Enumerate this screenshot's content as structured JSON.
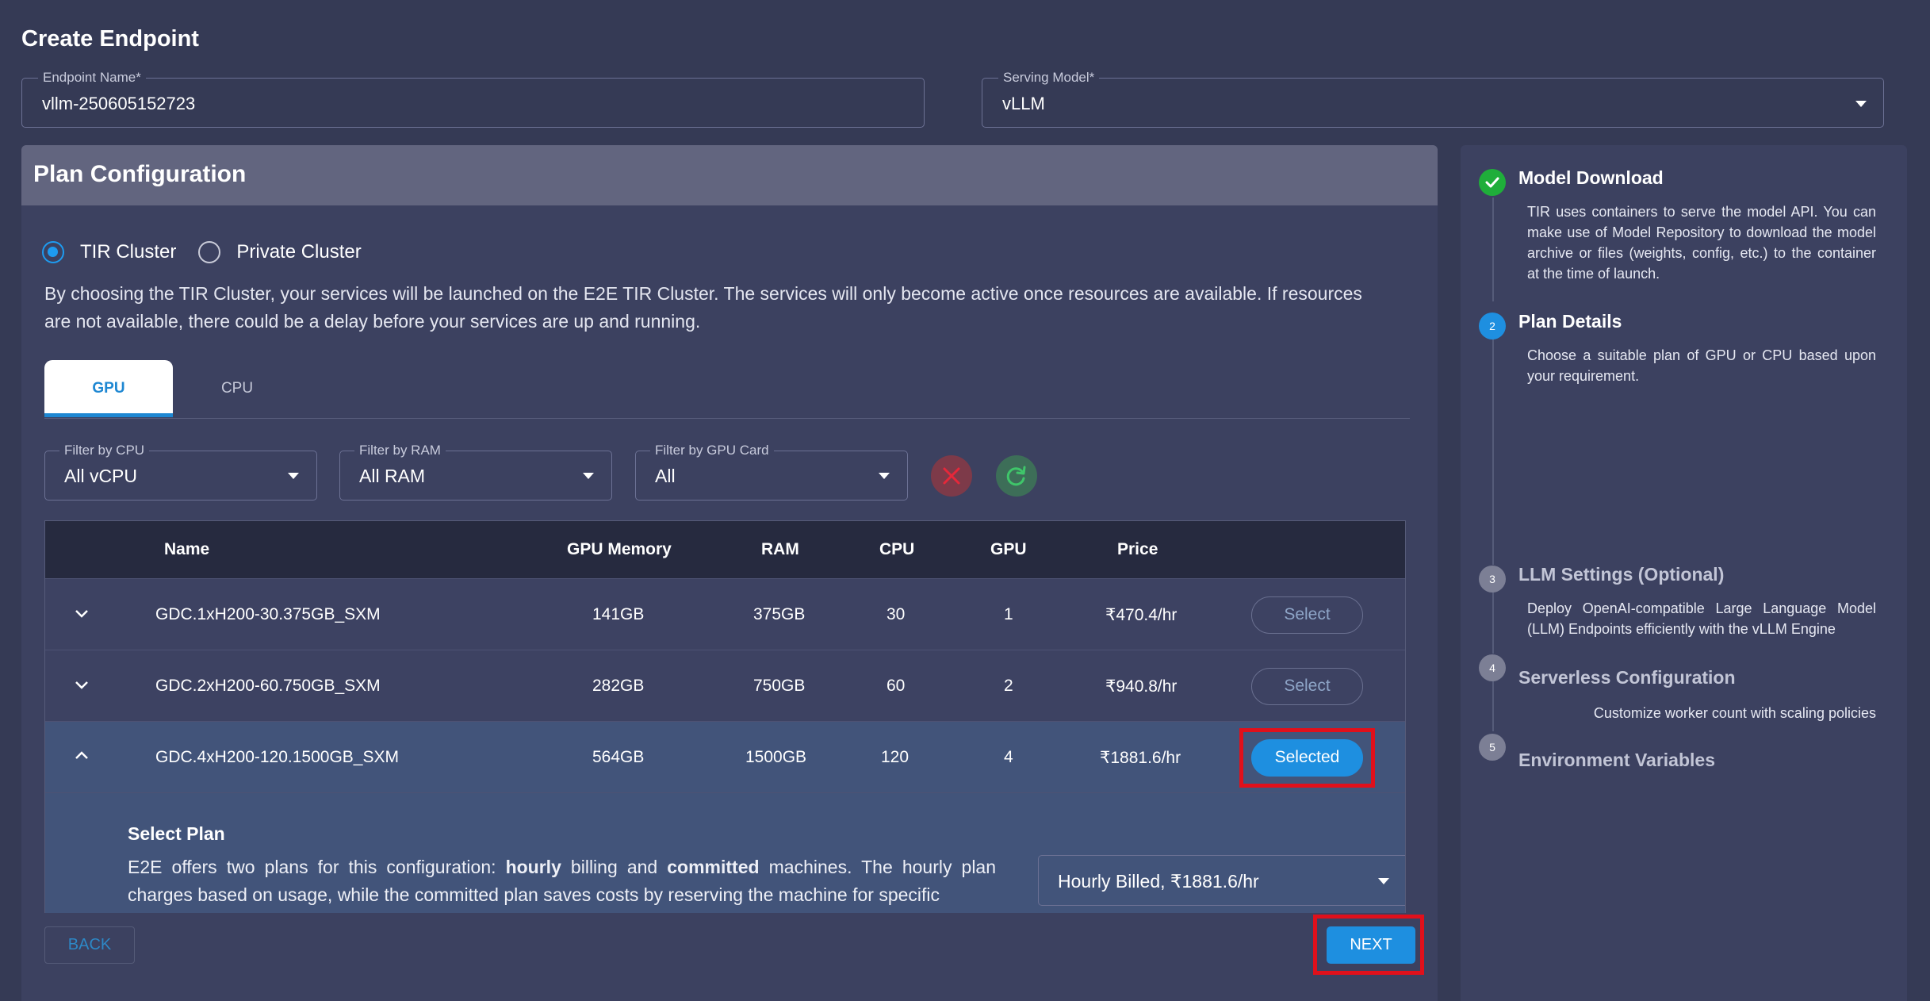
{
  "page": {
    "title": "Create Endpoint"
  },
  "endpoint_name": {
    "label": "Endpoint Name",
    "value": "vllm-250605152723"
  },
  "serving_model": {
    "label": "Serving Model",
    "value": "vLLM"
  },
  "plan": {
    "header": "Plan Configuration",
    "cluster_options": [
      "TIR Cluster",
      "Private Cluster"
    ],
    "selected_cluster": "TIR Cluster",
    "cluster_description": "By choosing the TIR Cluster, your services will be launched on the E2E TIR Cluster. The services will only become active once resources are available. If resources are not available, there could be a delay before your services are up and running.",
    "tabs": [
      "GPU",
      "CPU"
    ],
    "active_tab": "GPU",
    "filters": [
      {
        "label": "Filter by CPU",
        "value": "All vCPU"
      },
      {
        "label": "Filter by RAM",
        "value": "All RAM"
      },
      {
        "label": "Filter by GPU Card",
        "value": "All"
      }
    ],
    "table": {
      "columns": [
        "Name",
        "GPU Memory",
        "RAM",
        "CPU",
        "GPU",
        "Price"
      ],
      "rows": [
        {
          "name": "GDC.1xH200-30.375GB_SXM",
          "gpu_memory": "141GB",
          "ram": "375GB",
          "cpu": "30",
          "gpu": "1",
          "price": "₹470.4/hr",
          "action": "Select"
        },
        {
          "name": "GDC.2xH200-60.750GB_SXM",
          "gpu_memory": "282GB",
          "ram": "750GB",
          "cpu": "60",
          "gpu": "2",
          "price": "₹940.8/hr",
          "action": "Select"
        },
        {
          "name": "GDC.4xH200-120.1500GB_SXM",
          "gpu_memory": "564GB",
          "ram": "1500GB",
          "cpu": "120",
          "gpu": "4",
          "price": "₹1881.6/hr",
          "action": "Selected"
        }
      ]
    },
    "select_plan": {
      "title": "Select Plan",
      "text_1": "E2E offers two plans for this configuration: ",
      "bold_1": "hourly",
      "text_2": " billing and ",
      "bold_2": "committed",
      "text_3": " machines. The hourly plan charges based on usage, while the committed plan saves costs by reserving the machine for specific",
      "billing_value": "Hourly Billed, ₹1881.6/hr"
    },
    "back_label": "BACK",
    "next_label": "NEXT"
  },
  "steps": [
    {
      "num": "✓",
      "title": "Model Download",
      "desc": "TIR uses containers to serve the model API. You can make use of Model Repository to download the model archive or files (weights, config, etc.) to the container at the time of launch.",
      "state": "done"
    },
    {
      "num": "2",
      "title": "Plan Details",
      "desc": "Choose a suitable plan of GPU or CPU based upon your requirement.",
      "state": "active"
    },
    {
      "num": "3",
      "title": "LLM Settings (Optional)",
      "desc": "Deploy OpenAI-compatible Large Language Model (LLM) Endpoints efficiently with the vLLM Engine",
      "state": "pending"
    },
    {
      "num": "4",
      "title": "Serverless Configuration",
      "desc": "Customize worker count with scaling policies",
      "state": "pending"
    },
    {
      "num": "5",
      "title": "Environment Variables",
      "desc": "",
      "state": "pending"
    }
  ],
  "colors": {
    "accent": "#1e8fe0",
    "done": "#1fae3a",
    "highlight": "#e0101b"
  }
}
